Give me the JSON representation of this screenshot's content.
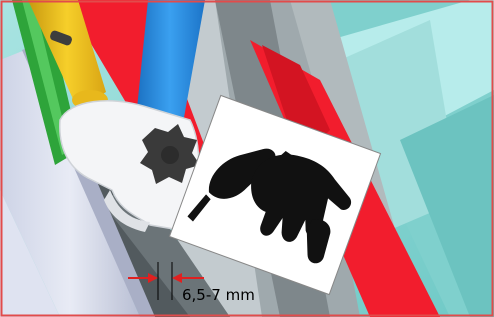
{
  "figure": {
    "dimension_label": "6,5-7 mm",
    "callout_icon": "hand-operating-tool-icon",
    "colors": {
      "border": "#e24b4b",
      "dimension_arrows": "#e02020",
      "tube_yellow": "#f2c21c",
      "tube_green": "#2ea43a",
      "tube_blue": "#2f8fe6",
      "panel_red": "#f21d2d",
      "teal_wall": "#8ed8d6",
      "grey_profile": "#b9c2c6",
      "knob": "#3a3a3a"
    }
  }
}
